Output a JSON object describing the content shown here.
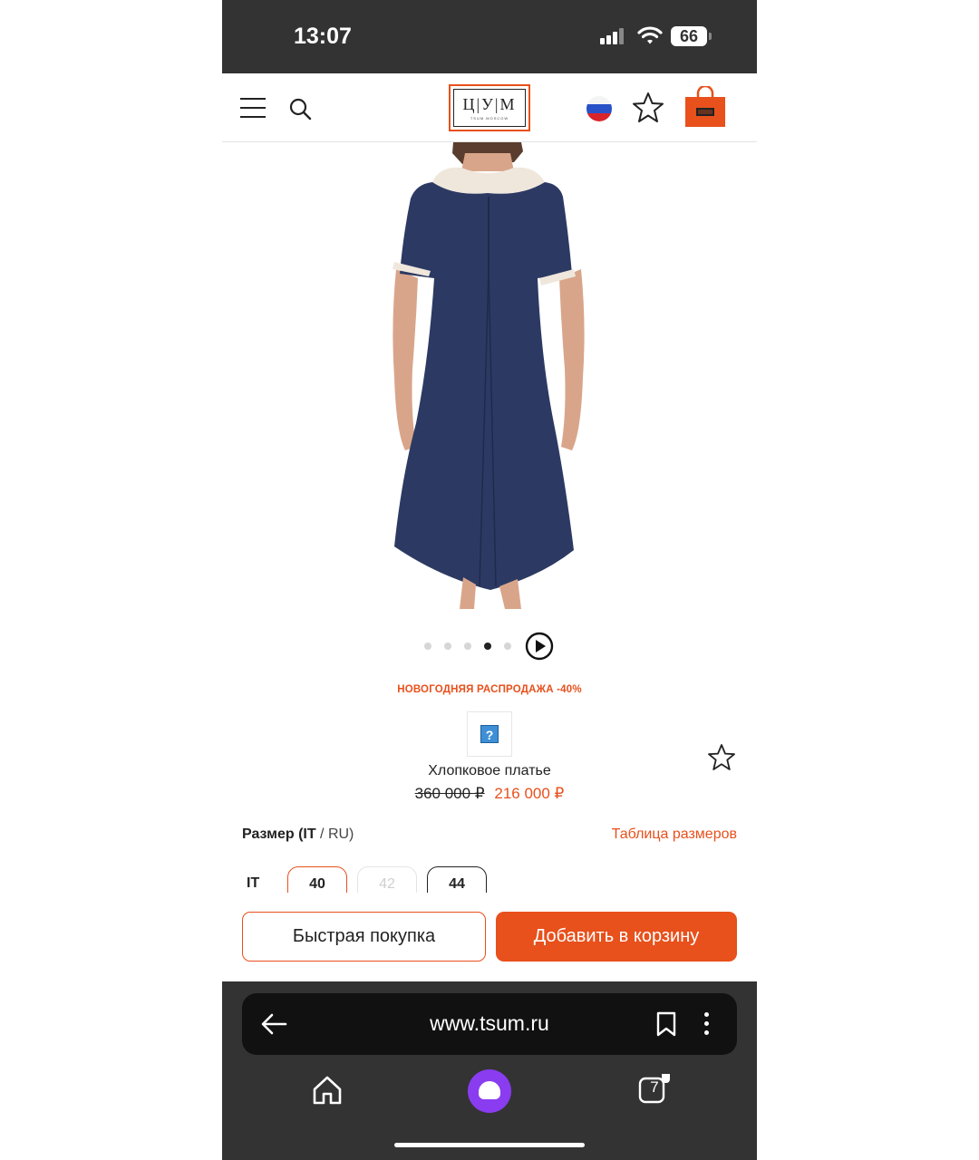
{
  "status_bar": {
    "time": "13:07",
    "battery": "66"
  },
  "header": {
    "logo_letters": "Ц|У|М",
    "logo_sub": "TSUM MOSCOW",
    "icons": [
      "menu-icon",
      "search-icon",
      "russia-flag-icon",
      "star-icon",
      "shopping-bag-icon"
    ]
  },
  "colors": {
    "accent": "#e8501c",
    "dark": "#333333",
    "dress": "#2c3a63",
    "collar": "#efe7dc"
  },
  "gallery": {
    "dots_count": 5,
    "active_dot": 3,
    "play_icon": "play-icon"
  },
  "product": {
    "promo": "НОВОГОДНЯЯ РАСПРОДАЖА -40%",
    "brand_placeholder": "?",
    "name": "Хлопковое платье",
    "old_price": "360 000 ₽",
    "new_price": "216 000 ₽"
  },
  "sizes": {
    "label_bold": "Размер (IT",
    "label_sep": " / RU)",
    "table_link": "Таблица размеров",
    "system": "IT",
    "options": [
      {
        "label": "40",
        "state": "selected"
      },
      {
        "label": "42",
        "state": "disabled"
      },
      {
        "label": "44",
        "state": "available"
      }
    ]
  },
  "actions": {
    "quick_buy": "Быстрая покупка",
    "add_to_cart": "Добавить в корзину"
  },
  "browser": {
    "url": "www.tsum.ru",
    "tabs_count": "7"
  }
}
